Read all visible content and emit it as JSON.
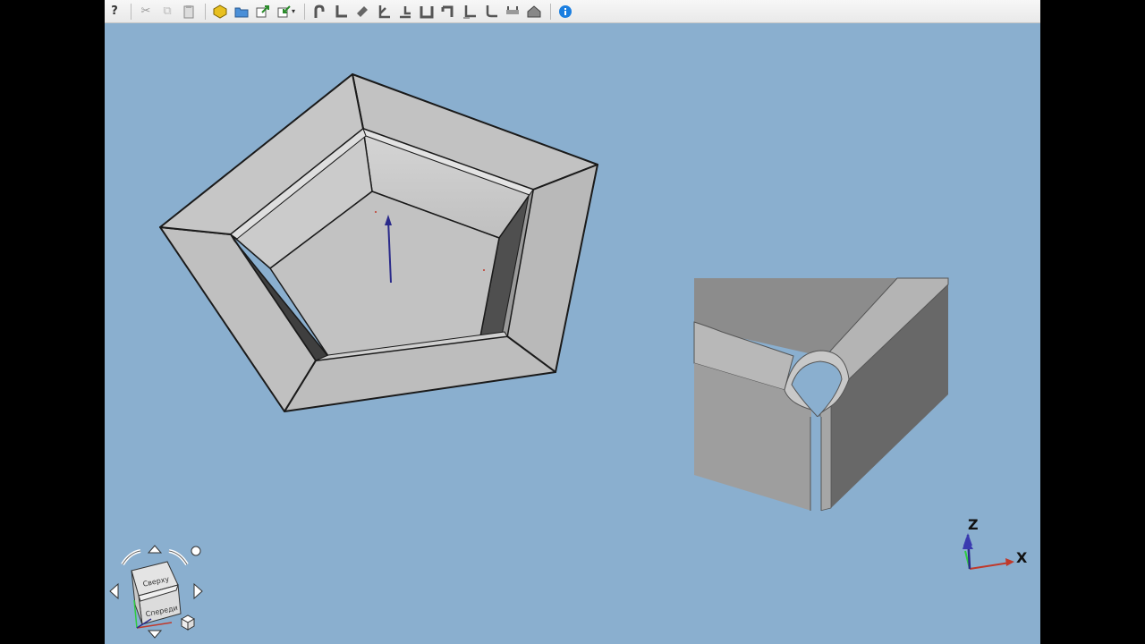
{
  "toolbar": {
    "buttons": [
      {
        "name": "whats-this-icon",
        "glyph": "?"
      },
      {
        "name": "cut-icon",
        "glyph": "✂"
      },
      {
        "name": "copy-icon",
        "glyph": "⧉"
      },
      {
        "name": "paste-icon",
        "glyph": "📋"
      },
      {
        "name": "make-part-icon",
        "glyph": "⬡"
      },
      {
        "name": "open-folder-icon",
        "glyph": "📁"
      },
      {
        "name": "export-icon",
        "glyph": "⇗"
      },
      {
        "name": "import-icon",
        "glyph": "⇘"
      },
      {
        "name": "bend-icon",
        "glyph": "⤴"
      },
      {
        "name": "wall-icon",
        "glyph": "∟"
      },
      {
        "name": "extend-icon",
        "glyph": "◆"
      },
      {
        "name": "relief-icon",
        "glyph": "∠"
      },
      {
        "name": "jog-icon",
        "glyph": "⊥"
      },
      {
        "name": "solid-bend-icon",
        "glyph": "▢"
      },
      {
        "name": "corner-icon",
        "glyph": "⌐"
      },
      {
        "name": "unattached-bend-icon",
        "glyph": "┗"
      },
      {
        "name": "reverse-icon",
        "glyph": "┗"
      },
      {
        "name": "unfold-icon",
        "glyph": "⇌"
      },
      {
        "name": "sketch-icon",
        "glyph": "⌂"
      },
      {
        "name": "info-icon",
        "glyph": "i"
      }
    ]
  },
  "navcube": {
    "top_face": "Сверху",
    "front_face": "Спереди"
  },
  "axes": {
    "x_label": "X",
    "z_label": "Z"
  },
  "colors": {
    "background": "#8aafcf",
    "face_light": "#c4c4c4",
    "face_mid": "#b8b8b8",
    "face_dark": "#555555",
    "edge": "#1a1a1a",
    "x_axis": "#c0392b",
    "y_axis": "#2ecc40",
    "z_axis": "#2a2a8a"
  }
}
